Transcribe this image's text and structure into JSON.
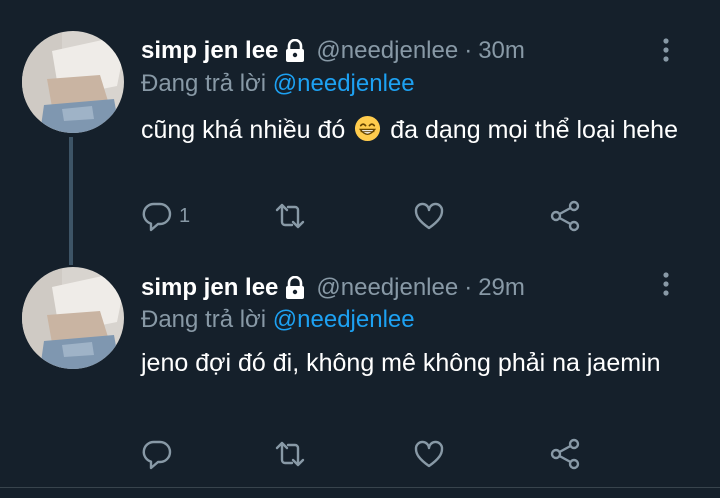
{
  "tweets": [
    {
      "display_name": "simp jen lee",
      "handle": "@needjenlee",
      "separator": "·",
      "time": "30m",
      "reply_prefix": "Đang trả lời",
      "reply_mention": "@needjenlee",
      "text_before_emoji": "cũng khá nhiều đó",
      "text_after_emoji": "đa dạng mọi thể loại hehe",
      "emoji": "grinning-face-with-smiling-eyes",
      "reply_count": "1"
    },
    {
      "display_name": "simp jen lee",
      "handle": "@needjenlee",
      "separator": "·",
      "time": "29m",
      "reply_prefix": "Đang trả lời",
      "reply_mention": "@needjenlee",
      "text": "jeno đợi đó đi, không mê không phải na jaemin",
      "reply_count": ""
    }
  ],
  "colors": {
    "background": "#15202b",
    "secondary_text": "#8899a6",
    "mention": "#1da1f2",
    "thread_line": "#3d5466"
  },
  "icons": [
    "lock-icon",
    "more-icon",
    "reply-icon",
    "retweet-icon",
    "like-icon",
    "share-icon"
  ]
}
